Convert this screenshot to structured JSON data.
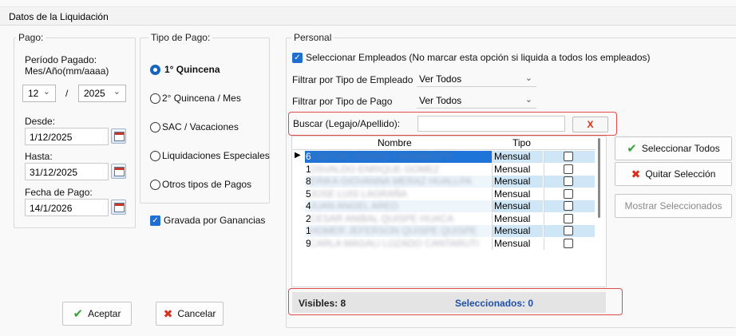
{
  "window": {
    "title": "Datos de la Liquidación"
  },
  "pago": {
    "group_title": "Pago:",
    "periodo_label": "Período Pagado:\nMes/Año(mm/aaaa)",
    "mes": "12",
    "separator": "/",
    "anio": "2025",
    "desde_label": "Desde:",
    "desde_value": "1/12/2025",
    "hasta_label": "Hasta:",
    "hasta_value": "31/12/2025",
    "fecha_pago_label": "Fecha de Pago:",
    "fecha_pago_value": "14/1/2026"
  },
  "tipo_pago": {
    "group_title": "Tipo de Pago:",
    "options": [
      {
        "label": "1° Quincena",
        "selected": true
      },
      {
        "label": "2° Quincena / Mes",
        "selected": false
      },
      {
        "label": "SAC / Vacaciones",
        "selected": false
      },
      {
        "label": "Liquidaciones Especiales",
        "selected": false
      },
      {
        "label": "Otros tipos de Pagos",
        "selected": false
      }
    ],
    "gravada_label": "Gravada por Ganancias",
    "gravada_checked": true
  },
  "personal": {
    "group_title": "Personal",
    "seleccionar_label": "Seleccionar Empleados (No marcar esta opción si liquida a todos los empleados)",
    "seleccionar_checked": true,
    "filtro_empleado_label": "Filtrar por Tipo de Empleado",
    "filtro_empleado_value": "Ver Todos",
    "filtro_pago_label": "Filtrar por Tipo de Pago",
    "filtro_pago_value": "Ver Todos",
    "buscar_label": "Buscar (Legajo/Apellido):",
    "buscar_value": "",
    "clear_label": "X",
    "grid": {
      "col_nombre": "Nombre",
      "col_tipo": "Tipo",
      "rows": [
        {
          "num": "6",
          "name": "CASTRO SERGIO CANTARUTTI",
          "tipo": "Mensual"
        },
        {
          "num": "1",
          "name": "OSVALDO ENRIQUE GOMEZ",
          "tipo": "Mensual"
        },
        {
          "num": "8",
          "name": "ERIKA GIOVANNA MERAZ HUALLPA",
          "tipo": "Mensual"
        },
        {
          "num": "5",
          "name": "JOSE LUIS LAGRAÑA",
          "tipo": "Mensual"
        },
        {
          "num": "4",
          "name": "JUAN ANGEL AREO",
          "tipo": "Mensual"
        },
        {
          "num": "2",
          "name": "CESAR ANIBAL QUISPE HUACA",
          "tipo": "Mensual"
        },
        {
          "num": "1",
          "name": "HOMER JEFERSON QUISPE QUISPE",
          "tipo": "Mensual"
        },
        {
          "num": "9",
          "name": "CARLA MAGALI LOZADO CANTARUTI",
          "tipo": "Mensual"
        }
      ]
    },
    "visibles_label": "Visibles: 8",
    "seleccionados_label": "Seleccionados: 0"
  },
  "actions": {
    "seleccionar_todos": "Seleccionar Todos",
    "quitar_seleccion": "Quitar Selección",
    "mostrar_seleccionados": "Mostrar Seleccionados",
    "aceptar": "Aceptar",
    "cancelar": "Cancelar"
  },
  "colors": {
    "accent": "#1f6fd1",
    "row_alt": "#cfe6f7",
    "highlight": "#e14a4a",
    "selected_count": "#1f4fa8"
  }
}
